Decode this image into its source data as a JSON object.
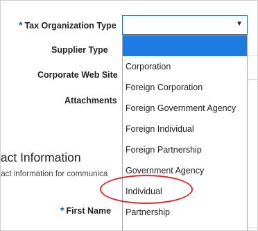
{
  "form": {
    "tax_org_type": {
      "label": "Tax Organization Type",
      "required_marker": "*"
    },
    "supplier_type": {
      "label": "Supplier Type"
    },
    "corporate_web_site": {
      "label": "Corporate Web Site"
    },
    "attachments": {
      "label": "Attachments"
    },
    "first_name": {
      "label": "First Name",
      "required_marker": "*"
    }
  },
  "contact": {
    "section_title": "tact Information",
    "section_subtitle": "tact information for communica"
  },
  "dropdown": {
    "selected_value": "",
    "arrow_icon": "caret-down-icon",
    "highlight_color": "#1e7be3",
    "options": [
      "Corporation",
      "Foreign Corporation",
      "Foreign Government Agency",
      "Foreign Individual",
      "Foreign Partnership",
      "Government Agency",
      "Individual",
      "Partnership"
    ]
  },
  "annotation": {
    "circle_color": "#e6252a"
  }
}
